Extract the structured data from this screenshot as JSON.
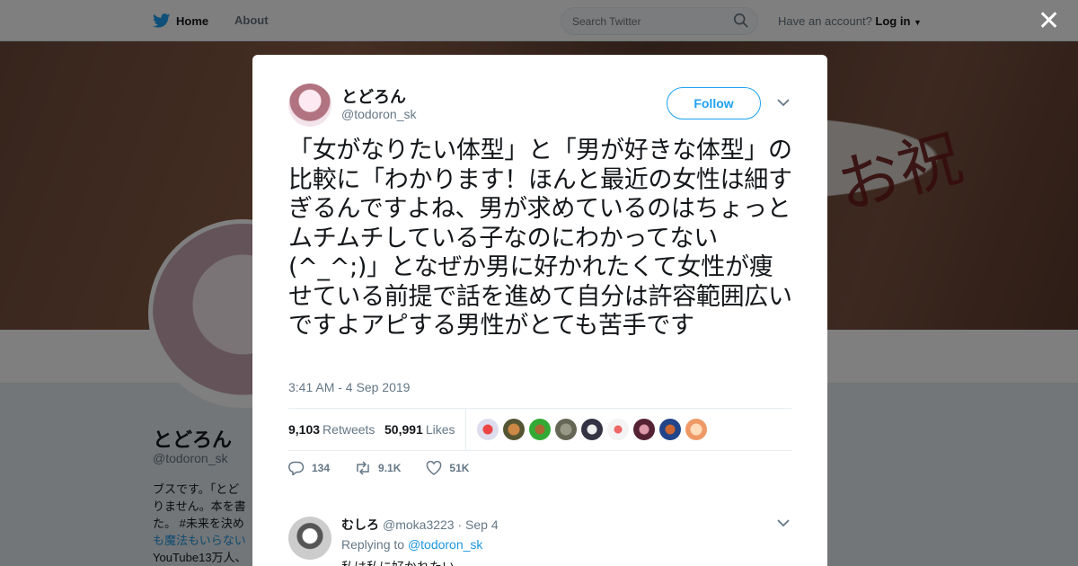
{
  "nav": {
    "home_label": "Home",
    "about_label": "About",
    "search_placeholder": "Search Twitter",
    "account_prompt": "Have an account?",
    "login_label": "Log in"
  },
  "background_profile": {
    "name": "とどろん",
    "handle": "@todoron_sk",
    "bio_lines": [
      "ブスです。「とど",
      "りません。本を書",
      "た。 #未来を決め",
      "も魔法もいらない",
      "YouTube13万人、"
    ]
  },
  "tweet": {
    "author_name": "とどろん",
    "author_handle": "@todoron_sk",
    "follow_label": "Follow",
    "text": "「女がなりたい体型」と「男が好きな体型」の比較に「わかります！ほんと最近の女性は細すぎるんですよね、男が求めているのはちょっとムチムチしている子なのにわかってない(^_^;)」となぜか男に好かれたくて女性が痩せている前提で話を進めて自分は許容範囲広いですよアピする男性がとても苦手です",
    "timestamp": "3:41 AM - 4 Sep 2019",
    "retweets_count": "9,103",
    "retweets_label": "Retweets",
    "likes_count": "50,991",
    "likes_label": "Likes",
    "reply_count": "134",
    "retweet_count_short": "9.1K",
    "like_count_short": "51K"
  },
  "reply": {
    "author_name": "むしろ",
    "author_handle": "@moka3223",
    "date": "· Sep 4",
    "replying_prefix": "Replying to",
    "replying_to": "@todoron_sk",
    "text": "私は私に好かれたい"
  },
  "colors": {
    "accent": "#1da1f2",
    "link": "#1b95e0",
    "muted": "#657786"
  }
}
